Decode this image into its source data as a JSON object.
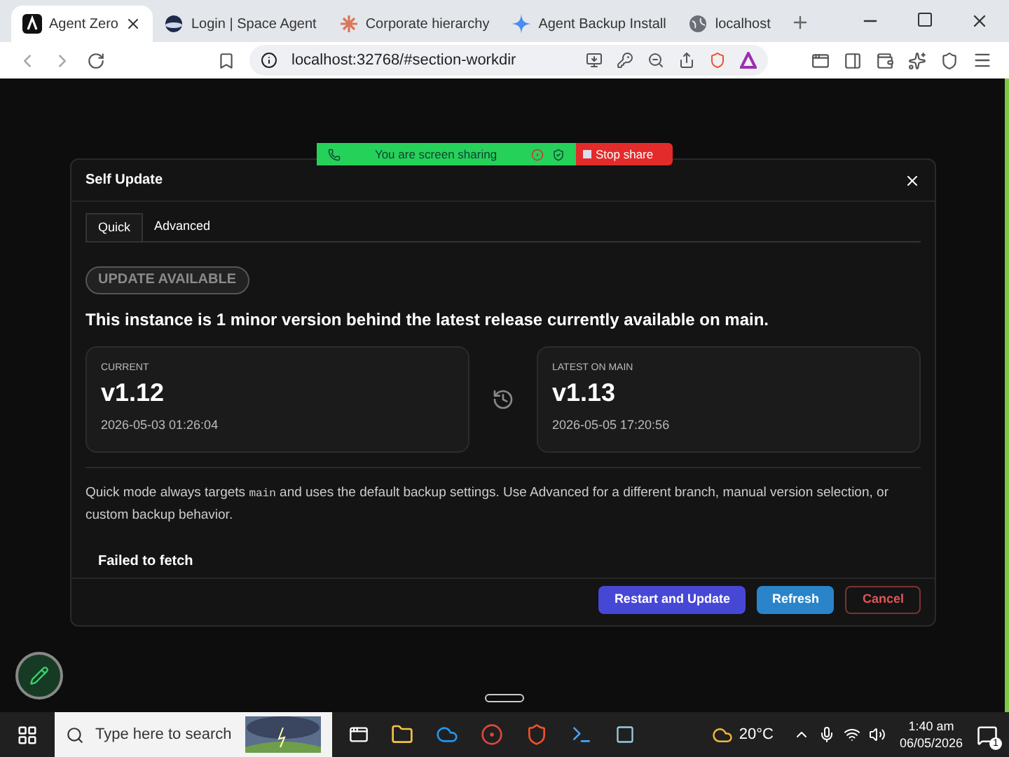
{
  "browser": {
    "tabs": [
      {
        "title": "Agent Zero",
        "selected": true
      },
      {
        "title": "Login | Space Agent",
        "selected": false
      },
      {
        "title": "Corporate hierarchy",
        "selected": false
      },
      {
        "title": "Agent Backup Install",
        "selected": false
      },
      {
        "title": "localhost",
        "selected": false
      }
    ],
    "address": "localhost:32768/#section-workdir"
  },
  "screen_share": {
    "message": "You are screen sharing",
    "stop_label": "Stop share"
  },
  "dialog": {
    "title": "Self Update",
    "tabs": [
      {
        "label": "Quick",
        "selected": true
      },
      {
        "label": "Advanced",
        "selected": false
      }
    ],
    "badge": "UPDATE AVAILABLE",
    "summary": "This instance is 1 minor version behind the latest release currently available on main.",
    "versions": [
      {
        "label": "CURRENT",
        "version": "v1.12",
        "date": "2026-05-03 01:26:04"
      },
      {
        "label": "LATEST ON MAIN",
        "version": "v1.13",
        "date": "2026-05-05 17:20:56"
      }
    ],
    "note_before": "Quick mode always targets",
    "note_code": "main",
    "note_after": "and uses the default backup settings. Use Advanced for a different branch, manual version selection, or custom backup behavior.",
    "status": "Failed to fetch",
    "buttons": [
      {
        "label": "Restart and Update",
        "kind": "primary"
      },
      {
        "label": "Refresh",
        "kind": "secondary"
      },
      {
        "label": "Cancel",
        "kind": "danger"
      }
    ]
  },
  "taskbar": {
    "search_placeholder": "Type here to search",
    "weather": "20°C",
    "time": "1:40 am",
    "date": "06/05/2026",
    "notifications": "1"
  }
}
